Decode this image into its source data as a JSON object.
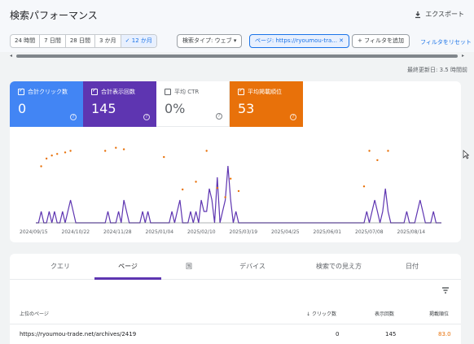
{
  "header": {
    "title": "検索パフォーマンス",
    "export_label": "エクスポート"
  },
  "filters": {
    "date_ranges": [
      "24 時間",
      "7 日間",
      "28 日間",
      "3 か月",
      "✓ 12 か月"
    ],
    "active_range": "✓ 12 か月",
    "search_type": "検索タイプ: ウェブ",
    "page_filter": "ページ: https://ryoumou-tra...",
    "add_filter": "フィルタを追加",
    "reset": "フィルタをリセット"
  },
  "last_updated": "最終更新日: 3.5 時間前",
  "metrics": [
    {
      "label": "合計クリック数",
      "value": "0",
      "checked": true,
      "color": "#4285f4"
    },
    {
      "label": "合計表示回数",
      "value": "145",
      "checked": true,
      "color": "#5e35b1"
    },
    {
      "label": "平均 CTR",
      "value": "0%",
      "checked": false,
      "color": "#ffffff"
    },
    {
      "label": "平均掲載順位",
      "value": "53",
      "checked": true,
      "color": "#e8710a"
    }
  ],
  "chart_data": {
    "type": "line",
    "x_tick_labels": [
      "2024/09/15",
      "2024/10/22",
      "2024/11/28",
      "2025/01/04",
      "2025/02/10",
      "2025/03/19",
      "2025/04/25",
      "2025/06/01",
      "2025/07/08",
      "2025/08/14"
    ],
    "ylim": [
      0,
      5
    ],
    "series": [
      {
        "name": "合計表示回数",
        "color": "#5e35b1",
        "values": [
          0,
          0,
          1,
          0,
          0,
          1,
          0,
          1,
          0,
          0,
          1,
          0,
          1,
          2,
          1,
          0,
          0,
          0,
          0,
          0,
          0,
          0,
          0,
          0,
          0,
          0,
          0,
          1,
          0,
          0,
          0,
          1,
          0,
          2,
          1,
          0,
          0,
          0,
          0,
          0,
          1,
          0,
          1,
          0,
          0,
          0,
          0,
          0,
          0,
          0,
          0,
          1,
          0,
          1,
          2,
          0,
          0,
          0,
          1,
          0,
          1,
          0,
          2,
          1,
          1,
          3,
          2,
          0,
          4,
          0,
          1,
          2,
          5,
          2,
          0,
          1,
          0,
          0,
          0,
          0,
          0,
          0,
          0,
          0,
          0,
          0,
          0,
          0,
          0,
          0,
          0,
          0,
          0,
          0,
          0,
          0,
          0,
          0,
          0,
          0,
          0,
          0,
          0,
          0,
          0,
          0,
          0,
          0,
          0,
          0,
          0,
          0,
          0,
          0,
          0,
          0,
          0,
          0,
          0,
          0,
          0,
          0,
          0,
          0,
          1,
          0,
          1,
          2,
          1,
          0,
          1,
          3,
          1,
          0,
          0,
          0,
          0,
          0,
          0,
          1,
          0,
          0,
          0,
          1,
          2,
          1,
          0,
          0,
          0,
          1,
          0,
          0,
          0
        ]
      },
      {
        "name": "平均掲載順位",
        "color": "#e8710a",
        "values": [
          null,
          null,
          40,
          null,
          35,
          null,
          33,
          null,
          32,
          null,
          null,
          31,
          null,
          30,
          null,
          null,
          null,
          null,
          null,
          null,
          null,
          null,
          null,
          null,
          null,
          null,
          30,
          null,
          null,
          null,
          28,
          null,
          null,
          29,
          null,
          null,
          null,
          null,
          null,
          null,
          null,
          null,
          null,
          null,
          null,
          null,
          null,
          null,
          34,
          null,
          null,
          null,
          null,
          null,
          null,
          55,
          null,
          null,
          null,
          null,
          50,
          null,
          null,
          null,
          30,
          null,
          null,
          null,
          54,
          null,
          null,
          60,
          null,
          48,
          null,
          null,
          56,
          null,
          null,
          null,
          null,
          null,
          null,
          null,
          null,
          null,
          null,
          null,
          null,
          null,
          null,
          null,
          null,
          null,
          null,
          null,
          null,
          null,
          null,
          null,
          null,
          null,
          null,
          null,
          null,
          null,
          null,
          null,
          null,
          null,
          null,
          null,
          null,
          null,
          null,
          null,
          null,
          null,
          null,
          null,
          null,
          null,
          null,
          53,
          null,
          30,
          null,
          null,
          36,
          null,
          null,
          null,
          30,
          null,
          null,
          null,
          null,
          null,
          null,
          null,
          null,
          null,
          null,
          null,
          null,
          null,
          null,
          null,
          null,
          null,
          null,
          null,
          null
        ]
      }
    ]
  },
  "tabs": [
    "クエリ",
    "ページ",
    "国",
    "デバイス",
    "検索での見え方",
    "日付"
  ],
  "active_tab": "ページ",
  "table": {
    "headers": [
      "上位のページ",
      "クリック数",
      "表示回数",
      "掲載順位"
    ],
    "rows": [
      {
        "page": "https://ryoumou-trade.net/archives/2419",
        "clicks": "0",
        "impressions": "145",
        "position": "83.0"
      }
    ]
  }
}
